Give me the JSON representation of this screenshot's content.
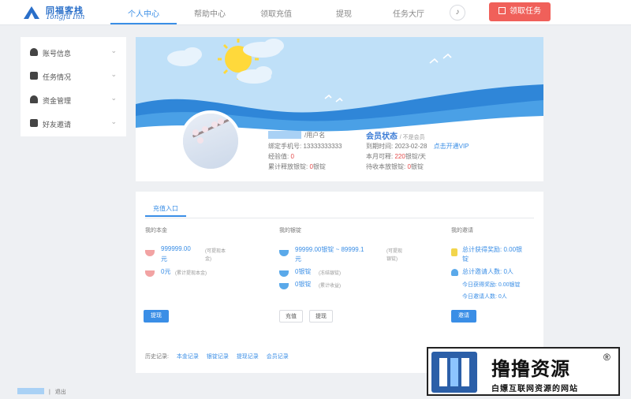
{
  "header": {
    "logo_cn": "同福客栈",
    "logo_en": "Tongfu Inn",
    "nav": [
      "个人中心",
      "帮助中心",
      "领取充值",
      "提现",
      "任务大厅"
    ],
    "active_index": 0,
    "bell_icon": "bell-icon",
    "cta_label": "领取任务",
    "accent": "#3a8ee6",
    "cta_color": "#f0605a"
  },
  "sidebar": {
    "items": [
      {
        "label": "账号信息",
        "icon": "user-icon"
      },
      {
        "label": "任务情况",
        "icon": "list-icon"
      },
      {
        "label": "资金管理",
        "icon": "money-icon"
      },
      {
        "label": "好友邀请",
        "icon": "mail-icon"
      }
    ]
  },
  "profile": {
    "username_suffix": "/用户名",
    "phone_label": "绑定手机号:",
    "phone_value": "13333333333",
    "exp_label": "经验值:",
    "exp_value": "0",
    "accum_label": "累计释放银锭:",
    "accum_value": "0",
    "accum_unit": "银锭",
    "status_title": "会员状态",
    "status_sub": "/ 不是会员",
    "expire_label": "到期时间:",
    "expire_value": "2023-02-28",
    "vip_link": "点击开通VIP",
    "monthly_label": "本月可释:",
    "monthly_value": "220",
    "monthly_unit": "银锭/天",
    "pending_label": "待收本放银锭:",
    "pending_value": "0",
    "pending_unit": "银锭"
  },
  "recharge": {
    "tab": "充值入口",
    "col1": {
      "title": "我的本金",
      "v1": "999999.00",
      "v1_unit": "元",
      "v1_note_a": "(可提现本",
      "v1_note_b": "金)",
      "v2": "0元",
      "v2_note": "(累计提现本金)",
      "btn": "提现"
    },
    "col2": {
      "title": "我的银锭",
      "v1": "99999.00银锭 ~ 89999.1",
      "v1_unit": "元",
      "v1_note_a": "(可提现",
      "v1_note_b": "银锭)",
      "v2": "0银锭",
      "v2_note": "(冻结银锭)",
      "v3": "0银锭",
      "v3_note": "(累计收益)",
      "btn1": "充值",
      "btn2": "提现"
    },
    "col3": {
      "title": "我的邀请",
      "v1": "总计获得奖励: 0.00银",
      "v1_b": "锭",
      "v2": "总计邀请人数: 0人",
      "v3": "今日获得奖励: 0.00银锭",
      "v4": "今日邀请人数: 0人",
      "btn": "邀请"
    },
    "history_label": "历史记录:",
    "history_links": [
      "本金记录",
      "银锭记录",
      "提现记录",
      "会员记录"
    ]
  },
  "footer": {
    "logout": "退出"
  },
  "watermark": {
    "title": "撸撸资源",
    "reg": "®",
    "subtitle": "白嫖互联网资源的网站"
  }
}
